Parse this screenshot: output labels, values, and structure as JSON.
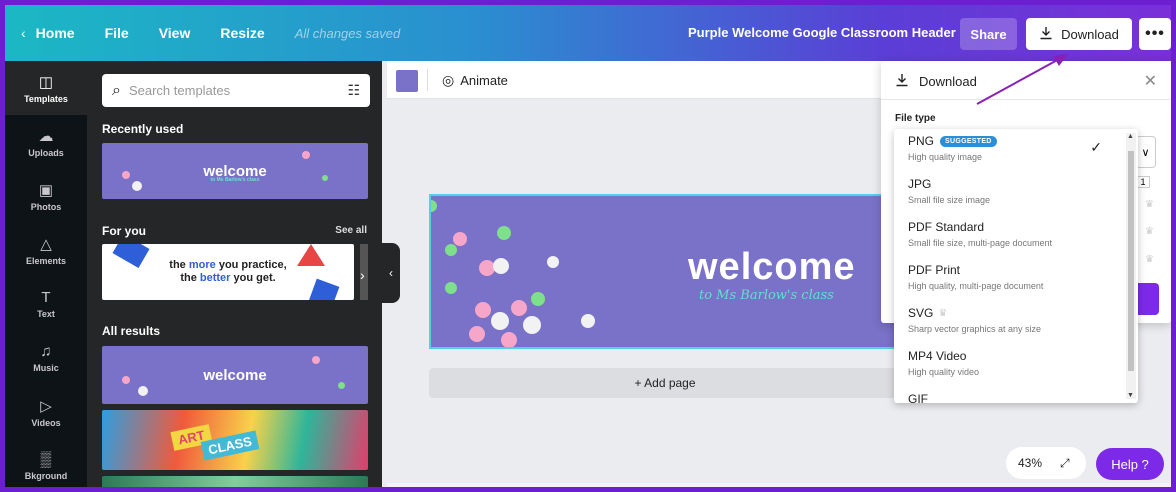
{
  "topbar": {
    "home": "Home",
    "file": "File",
    "view": "View",
    "resize": "Resize",
    "saved": "All changes saved",
    "title": "Purple Welcome Google Classroom Header",
    "share": "Share",
    "download": "Download",
    "more": "•••"
  },
  "rail": [
    {
      "label": "Templates",
      "icon": "templates-icon",
      "glyph": "◫"
    },
    {
      "label": "Uploads",
      "icon": "upload-icon",
      "glyph": "☁"
    },
    {
      "label": "Photos",
      "icon": "photo-icon",
      "glyph": "▣"
    },
    {
      "label": "Elements",
      "icon": "elements-icon",
      "glyph": "△"
    },
    {
      "label": "Text",
      "icon": "text-icon",
      "glyph": "T"
    },
    {
      "label": "Music",
      "icon": "music-icon",
      "glyph": "♫"
    },
    {
      "label": "Videos",
      "icon": "video-icon",
      "glyph": "▷"
    },
    {
      "label": "Bkground",
      "icon": "background-icon",
      "glyph": "▒"
    }
  ],
  "panel": {
    "search_placeholder": "Search templates",
    "recently_used": "Recently used",
    "for_you": "For you",
    "see_all": "See all",
    "all_results": "All results",
    "welcome": "welcome",
    "welcome_sub": "to Ms Barlow's class",
    "practice_1a": "the ",
    "practice_1b": "more",
    "practice_1c": " you practice,",
    "practice_2a": "the ",
    "practice_2b": "better",
    "practice_2c": " you get.",
    "art": "ART",
    "class": "CLASS"
  },
  "canvas": {
    "animate": "Animate",
    "welcome": "welcome",
    "to_class": "to Ms Barlow's class",
    "add_page": "+ Add page",
    "zoom": "43%",
    "help": "Help ?",
    "swatch_color": "#7a71c8"
  },
  "download_panel": {
    "title": "Download",
    "file_type_label": "File type",
    "selected": "PNG",
    "options": [
      {
        "name": "PNG",
        "badge": "SUGGESTED",
        "desc": "High quality image"
      },
      {
        "name": "JPG",
        "desc": "Small file size image"
      },
      {
        "name": "PDF Standard",
        "desc": "Small file size, multi-page document"
      },
      {
        "name": "PDF Print",
        "desc": "High quality, multi-page document"
      },
      {
        "name": "SVG",
        "desc": "Sharp vector graphics at any size"
      },
      {
        "name": "MP4 Video",
        "desc": "High quality video"
      },
      {
        "name": "GIF",
        "desc": ""
      }
    ],
    "size_value": "1"
  },
  "colors": {
    "accent": "#7d2ae8",
    "design_bg": "#7a71c8",
    "frame": "#6b1fd1"
  }
}
